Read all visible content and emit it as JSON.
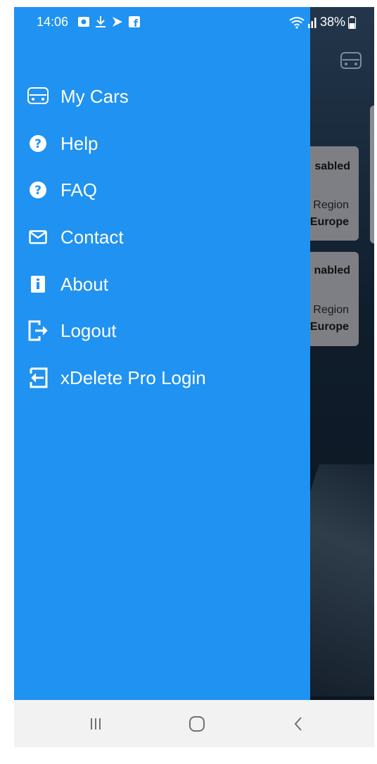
{
  "status_bar": {
    "time": "14:06",
    "battery": "38%",
    "icons": [
      "gallery-icon",
      "download-icon",
      "play-store-icon",
      "facebook-icon",
      "wifi-icon",
      "signal-icon",
      "battery-icon"
    ]
  },
  "drawer": {
    "color": "#2092f1",
    "items": [
      {
        "label": "My Cars",
        "icon": "car-icon"
      },
      {
        "label": "Help",
        "icon": "help-icon"
      },
      {
        "label": "FAQ",
        "icon": "faq-icon"
      },
      {
        "label": "Contact",
        "icon": "mail-icon"
      },
      {
        "label": "About",
        "icon": "info-icon"
      },
      {
        "label": "Logout",
        "icon": "logout-icon"
      },
      {
        "label": "xDelete Pro Login",
        "icon": "login-icon"
      }
    ]
  },
  "background": {
    "cards": [
      {
        "state": "sabled",
        "region_label": "Region",
        "region_value": "Europe"
      },
      {
        "state": "nabled",
        "region_label": "Region",
        "region_value": "Europe"
      }
    ]
  },
  "nav_bar": {
    "buttons": [
      "recent-apps-icon",
      "home-icon",
      "back-icon"
    ]
  }
}
